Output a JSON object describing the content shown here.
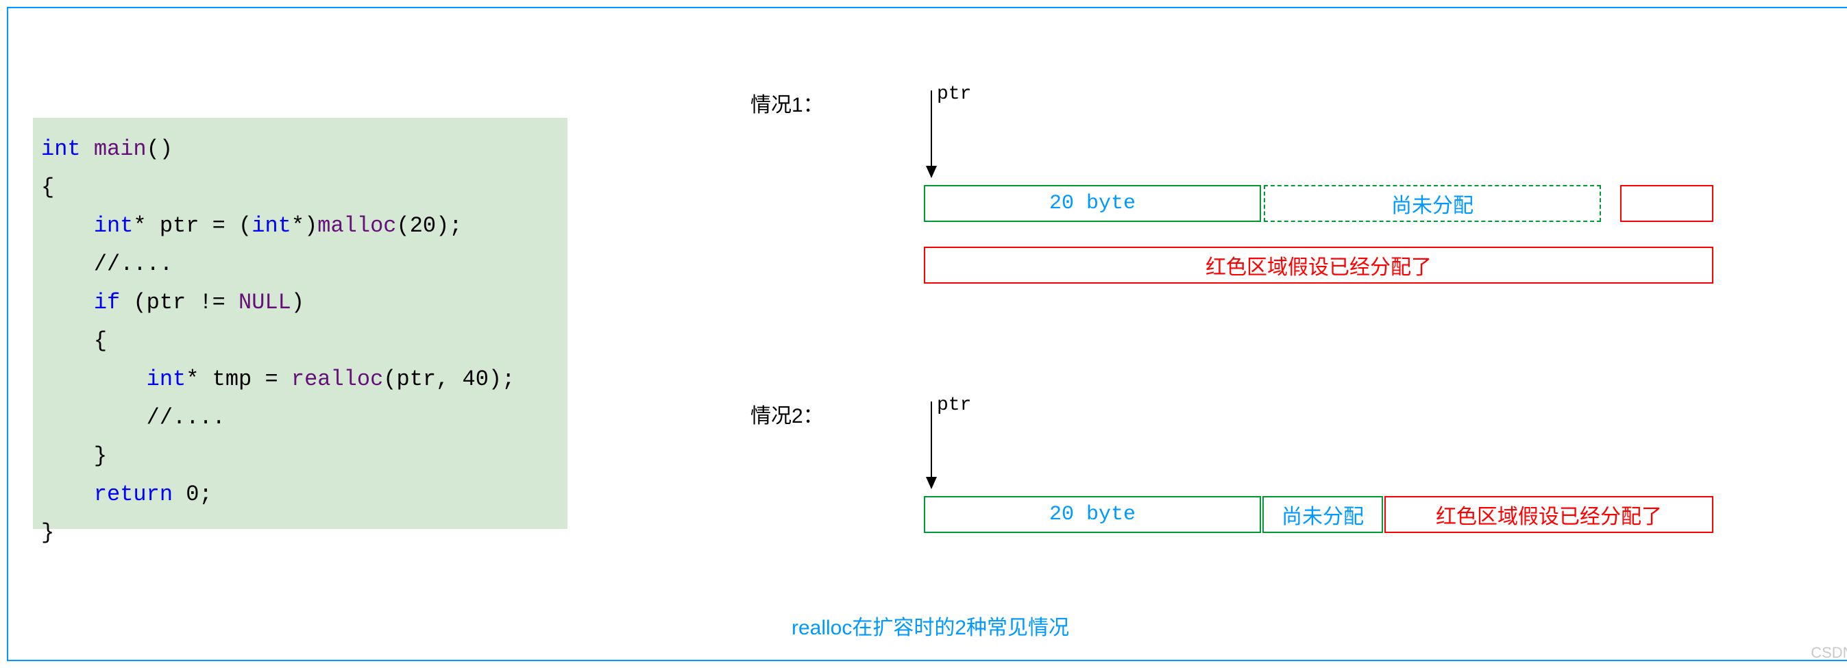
{
  "code": {
    "line1_kw": "int",
    "line1_fn": "main",
    "line1_rest": "()",
    "line2": "{",
    "line3_kw": "int",
    "line3_ptr": "* ptr = (",
    "line3_kw2": "int",
    "line3_cast": "*)",
    "line3_fn": "malloc",
    "line3_args": "(20);",
    "line4": "//....",
    "line5_kw": "if",
    "line5_cond_open": " (ptr != ",
    "line5_null": "NULL",
    "line5_cond_close": ")",
    "line6": "{",
    "line7_kw": "int",
    "line7_var": "* tmp = ",
    "line7_fn": "realloc",
    "line7_args": "(ptr, 40);",
    "line8": "//....",
    "line9": "}",
    "line10_kw": "return",
    "line10_val": " 0;",
    "line11": "}"
  },
  "case1": {
    "label": "情况1：",
    "ptr": "ptr",
    "box20": "20 byte",
    "boxUnalloc": "尚未分配",
    "boxRed": "红色区域假设已经分配了"
  },
  "case2": {
    "label": "情况2：",
    "ptr": "ptr",
    "box20": "20 byte",
    "boxUnalloc": "尚未分配",
    "boxRed": "红色区域假设已经分配了"
  },
  "caption": "realloc在扩容时的2种常见情况",
  "watermark": "CSDN @隔壁的老刘"
}
